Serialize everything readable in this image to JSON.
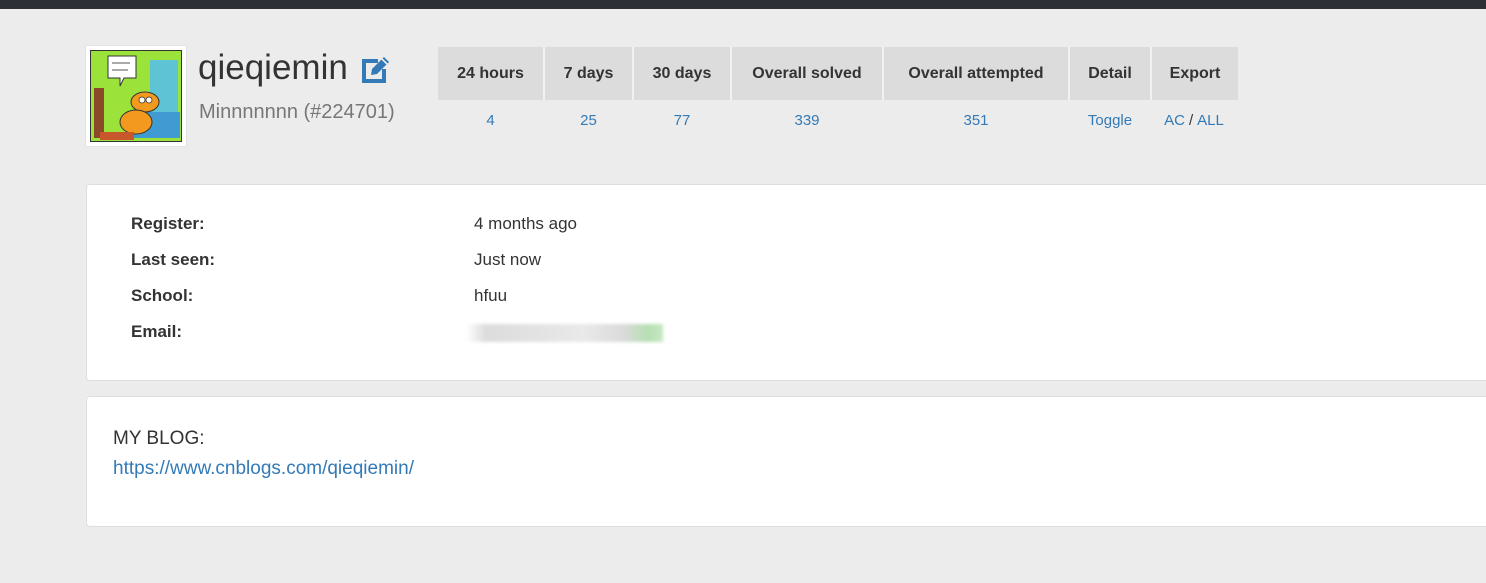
{
  "profile": {
    "username": "qieqiemin",
    "nickname": "Minnnnnnn (#224701)",
    "avatar_alt": "garfield-comic-avatar"
  },
  "stats": {
    "headers": [
      "24 hours",
      "7 days",
      "30 days",
      "Overall solved",
      "Overall attempted",
      "Detail",
      "Export"
    ],
    "values": [
      "4",
      "25",
      "77",
      "339",
      "351",
      "Toggle"
    ],
    "export_ac": "AC",
    "export_sep": "/",
    "export_all": "ALL"
  },
  "info": {
    "register_label": "Register:",
    "register_value": "4 months ago",
    "last_seen_label": "Last seen:",
    "last_seen_value": "Just now",
    "school_label": "School:",
    "school_value": "hfuu",
    "email_label": "Email:"
  },
  "blog": {
    "title": "MY BLOG:",
    "link": "https://www.cnblogs.com/qieqiemin/"
  },
  "colors": {
    "link": "#337ab7",
    "topbar": "#2d3135",
    "background": "#ececec",
    "header_cell": "#dcdcdc"
  },
  "icons": {
    "edit": "edit-icon"
  }
}
